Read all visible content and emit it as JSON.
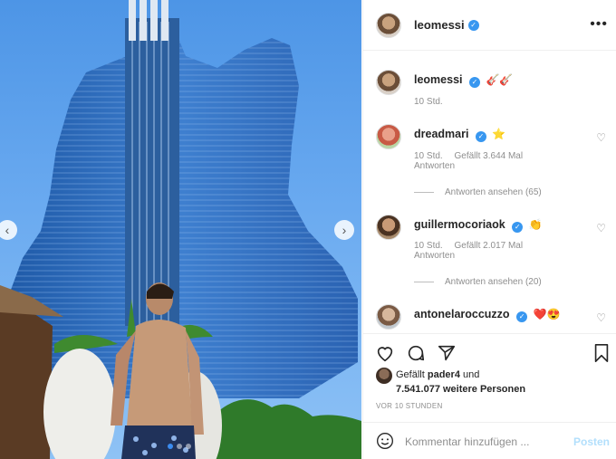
{
  "post": {
    "author": "leomessi",
    "more_icon": "more-dots-icon",
    "caption": {
      "username": "leomessi",
      "emojis": "🎸🎸",
      "time": "10 Std."
    },
    "photo": {
      "description_icon": "guitar-hotel-photo",
      "prev_icon": "chevron-left-icon",
      "next_icon": "chevron-right-icon",
      "carousel_dots": 3,
      "active_dot": 0
    }
  },
  "comments": [
    {
      "username": "dreadmari",
      "verified": true,
      "emojis": "⭐",
      "time": "10 Std.",
      "likes": "Gefällt 3.644 Mal",
      "reply": "Antworten",
      "view_replies": "Antworten ansehen (65)"
    },
    {
      "username": "guillermocoriaok",
      "verified": true,
      "emojis": "👏",
      "time": "10 Std.",
      "likes": "Gefällt 2.017 Mal",
      "reply": "Antworten",
      "view_replies": "Antworten ansehen (20)"
    },
    {
      "username": "antonelaroccuzzo",
      "verified": true,
      "emojis": "❤️😍"
    }
  ],
  "actions": {
    "like_icon": "heart-icon",
    "comment_icon": "comment-icon",
    "share_icon": "send-icon",
    "save_icon": "bookmark-icon"
  },
  "likes_summary": {
    "line1_prefix": "Gefällt ",
    "line1_user": "pader4",
    "line1_suffix": " und",
    "line2_count": "7.541.077 weitere Personen"
  },
  "timestamp": "VOR 10 STUNDEN",
  "composer": {
    "placeholder": "Kommentar hinzufügen ...",
    "post_label": "Posten"
  },
  "colors": {
    "verified": "#3897f0",
    "post_disabled": "#b2dffc",
    "muted": "#8e8e8e"
  }
}
